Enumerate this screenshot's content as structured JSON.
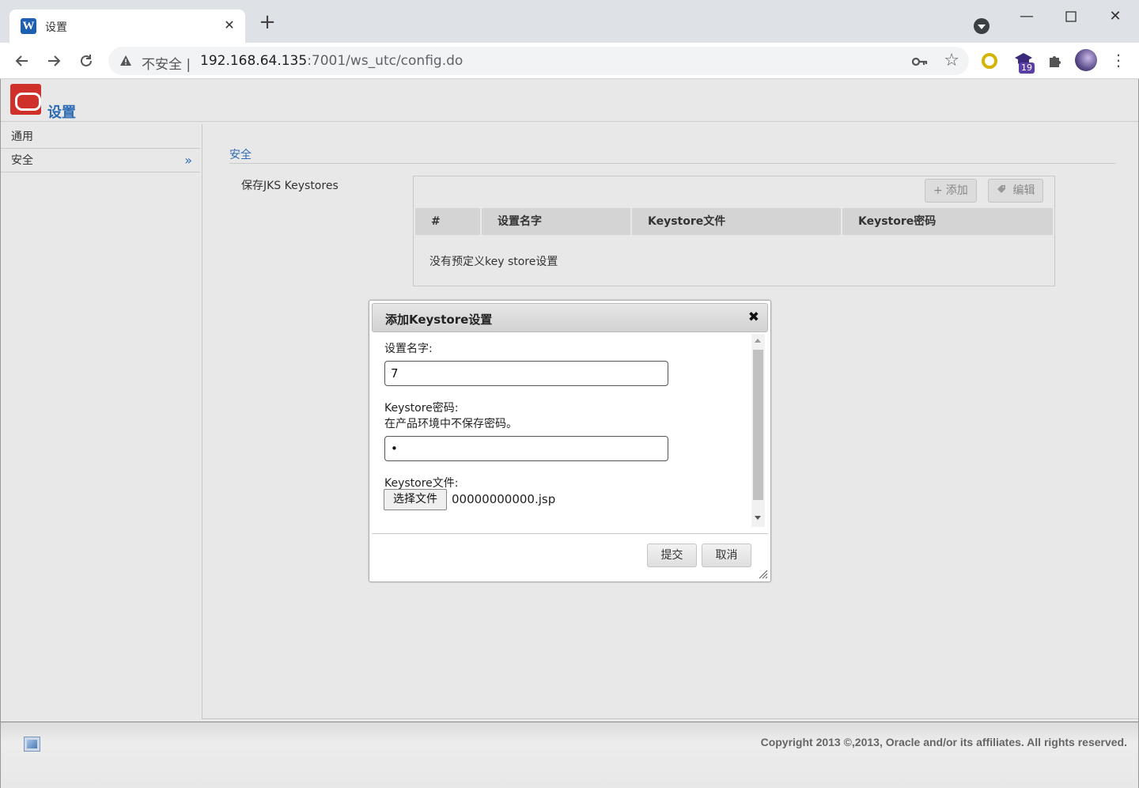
{
  "browser": {
    "tab_title": "设置",
    "tab_favicon_letter": "W",
    "new_tab_label": "+",
    "insecure_label": "不安全",
    "url_host": "192.168.64.135",
    "url_path": ":7001/ws_utc/config.do",
    "extension_badge": "19",
    "icons": [
      "back-icon",
      "forward-icon",
      "reload-icon",
      "warning-icon",
      "key-icon",
      "star-icon",
      "puzzle-icon",
      "more-icon"
    ]
  },
  "app": {
    "title": "设置"
  },
  "sidebar": {
    "items": [
      {
        "label": "通用"
      },
      {
        "label": "安全"
      }
    ]
  },
  "section": {
    "title": "安全",
    "field_label": "保存JKS Keystores"
  },
  "grid": {
    "add_label": "添加",
    "edit_label": "编辑",
    "columns": [
      "#",
      "设置名字",
      "Keystore文件",
      "Keystore密码"
    ],
    "empty_message": "没有预定义key store设置"
  },
  "dialog": {
    "title": "添加Keystore设置",
    "name_label": "设置名字:",
    "name_value": "7",
    "password_label": "Keystore密码:",
    "password_hint": "在产品环境中不保存密码。",
    "password_value": "•",
    "file_label": "Keystore文件:",
    "file_button": "选择文件",
    "file_name": "00000000000.jsp",
    "submit_label": "提交",
    "cancel_label": "取消"
  },
  "footer": {
    "copyright": "Copyright 2013 ©,2013, Oracle and/or its affiliates. All rights reserved."
  },
  "colors": {
    "accent": "#2e6cb5",
    "oracle_red": "#d0302a",
    "background": "#e8e8e8"
  }
}
